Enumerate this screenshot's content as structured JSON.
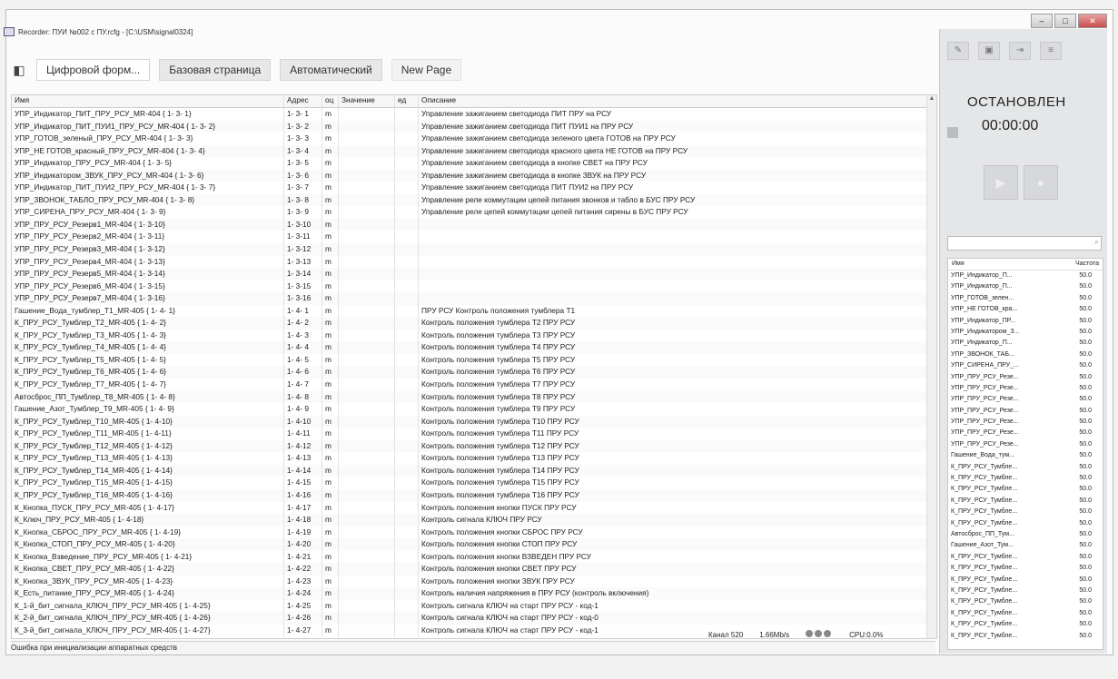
{
  "window": {
    "title": "Recorder: ПУИ №002 с ПУ.rcfg - [C:\\USM\\signal0324]"
  },
  "toolbar": {
    "tabs": [
      "Цифровой форм...",
      "Базовая страница",
      "Автоматический",
      "New Page"
    ]
  },
  "grid": {
    "columns": [
      "Имя",
      "Адрес",
      "оц",
      "Значение",
      "ед",
      "Описание"
    ],
    "rows": [
      [
        "УПР_Индикатор_ПИТ_ПРУ_РСУ_MR-404 { 1- 3- 1}",
        "1- 3- 1",
        "m",
        "",
        "",
        "Управление зажиганием светодиода ПИТ ПРУ на РСУ"
      ],
      [
        "УПР_Индикатор_ПИТ_ПУИ1_ПРУ_РСУ_MR-404 { 1- 3- 2}",
        "1- 3- 2",
        "m",
        "",
        "",
        "Управление зажиганием светодиода ПИТ ПУИ1 на ПРУ РСУ"
      ],
      [
        "УПР_ГОТОВ_зеленый_ПРУ_РСУ_MR-404 { 1- 3- 3}",
        "1- 3- 3",
        "m",
        "",
        "",
        "Управление зажиганием светодиода зеленого цвета ГОТОВ на ПРУ РСУ"
      ],
      [
        "УПР_НЕ ГОТОВ_красный_ПРУ_РСУ_MR-404 { 1- 3- 4}",
        "1- 3- 4",
        "m",
        "",
        "",
        "Управление зажиганием светодиода красного цвета НЕ ГОТОВ на ПРУ РСУ"
      ],
      [
        "УПР_Индикатор_ПРУ_РСУ_MR-404 { 1- 3- 5}",
        "1- 3- 5",
        "m",
        "",
        "",
        "Управление зажиганием светодиода в кнопке СВЕТ на ПРУ РСУ"
      ],
      [
        "УПР_Индикатором_ЗВУК_ПРУ_РСУ_MR-404 { 1- 3- 6}",
        "1- 3- 6",
        "m",
        "",
        "",
        "Управление зажиганием светодиода в кнопке ЗВУК на ПРУ РСУ"
      ],
      [
        "УПР_Индикатор_ПИТ_ПУИ2_ПРУ_РСУ_MR-404 { 1- 3- 7}",
        "1- 3- 7",
        "m",
        "",
        "",
        "Управление зажиганием светодиода ПИТ ПУИ2 на ПРУ РСУ"
      ],
      [
        "УПР_ЗВОНОК_ТАБЛО_ПРУ_РСУ_MR-404 { 1- 3- 8}",
        "1- 3- 8",
        "m",
        "",
        "",
        "Управление реле коммутации цепей питания звонков и табло в БУС ПРУ РСУ"
      ],
      [
        "УПР_СИРЕНА_ПРУ_РСУ_MR-404 { 1- 3- 9}",
        "1- 3- 9",
        "m",
        "",
        "",
        "Управление реле цепей коммутации цепей питания сирены в БУС ПРУ РСУ"
      ],
      [
        "УПР_ПРУ_РСУ_Резерв1_MR-404 { 1- 3-10}",
        "1- 3-10",
        "m",
        "",
        "",
        ""
      ],
      [
        "УПР_ПРУ_РСУ_Резерв2_MR-404 { 1- 3-11}",
        "1- 3-11",
        "m",
        "",
        "",
        ""
      ],
      [
        "УПР_ПРУ_РСУ_Резерв3_MR-404 { 1- 3-12}",
        "1- 3-12",
        "m",
        "",
        "",
        ""
      ],
      [
        "УПР_ПРУ_РСУ_Резерв4_MR-404 { 1- 3-13}",
        "1- 3-13",
        "m",
        "",
        "",
        ""
      ],
      [
        "УПР_ПРУ_РСУ_Резерв5_MR-404 { 1- 3-14}",
        "1- 3-14",
        "m",
        "",
        "",
        ""
      ],
      [
        "УПР_ПРУ_РСУ_Резерв6_MR-404 { 1- 3-15}",
        "1- 3-15",
        "m",
        "",
        "",
        ""
      ],
      [
        "УПР_ПРУ_РСУ_Резерв7_MR-404 { 1- 3-16}",
        "1- 3-16",
        "m",
        "",
        "",
        ""
      ],
      [
        "Гашение_Вода_тумблер_Т1_MR-405 { 1- 4- 1}",
        "1- 4- 1",
        "m",
        "",
        "",
        "ПРУ РСУ Контроль положения тумблера Т1"
      ],
      [
        "К_ПРУ_РСУ_Тумблер_Т2_MR-405 { 1- 4- 2}",
        "1- 4- 2",
        "m",
        "",
        "",
        "Контроль положения тумблера Т2 ПРУ РСУ"
      ],
      [
        "К_ПРУ_РСУ_Тумблер_Т3_MR-405 { 1- 4- 3}",
        "1- 4- 3",
        "m",
        "",
        "",
        "Контроль положения тумблера Т3 ПРУ РСУ"
      ],
      [
        "К_ПРУ_РСУ_Тумблер_Т4_MR-405 { 1- 4- 4}",
        "1- 4- 4",
        "m",
        "",
        "",
        "Контроль положения тумблера Т4 ПРУ РСУ"
      ],
      [
        "К_ПРУ_РСУ_Тумблер_Т5_MR-405 { 1- 4- 5}",
        "1- 4- 5",
        "m",
        "",
        "",
        "Контроль положения тумблера Т5 ПРУ РСУ"
      ],
      [
        "К_ПРУ_РСУ_Тумблер_Т6_MR-405 { 1- 4- 6}",
        "1- 4- 6",
        "m",
        "",
        "",
        "Контроль положения тумблера Т6 ПРУ РСУ"
      ],
      [
        "К_ПРУ_РСУ_Тумблер_Т7_MR-405 { 1- 4- 7}",
        "1- 4- 7",
        "m",
        "",
        "",
        "Контроль положения тумблера Т7 ПРУ РСУ"
      ],
      [
        "Автосброс_ПП_Тумблер_Т8_MR-405 { 1- 4- 8}",
        "1- 4- 8",
        "m",
        "",
        "",
        "Контроль положения тумблера Т8 ПРУ РСУ"
      ],
      [
        "Гашение_Азот_Тумблер_Т9_MR-405 { 1- 4- 9}",
        "1- 4- 9",
        "m",
        "",
        "",
        "Контроль положения тумблера Т9 ПРУ РСУ"
      ],
      [
        "К_ПРУ_РСУ_Тумблер_Т10_MR-405 { 1- 4-10}",
        "1- 4-10",
        "m",
        "",
        "",
        "Контроль положения тумблера Т10 ПРУ РСУ"
      ],
      [
        "К_ПРУ_РСУ_Тумблер_Т11_MR-405 { 1- 4-11}",
        "1- 4-11",
        "m",
        "",
        "",
        "Контроль положения тумблера Т11 ПРУ РСУ"
      ],
      [
        "К_ПРУ_РСУ_Тумблер_Т12_MR-405 { 1- 4-12}",
        "1- 4-12",
        "m",
        "",
        "",
        "Контроль положения тумблера Т12 ПРУ РСУ"
      ],
      [
        "К_ПРУ_РСУ_Тумблер_Т13_MR-405 { 1- 4-13}",
        "1- 4-13",
        "m",
        "",
        "",
        "Контроль положения тумблера Т13 ПРУ РСУ"
      ],
      [
        "К_ПРУ_РСУ_Тумблер_Т14_MR-405 { 1- 4-14}",
        "1- 4-14",
        "m",
        "",
        "",
        "Контроль положения тумблера Т14 ПРУ РСУ"
      ],
      [
        "К_ПРУ_РСУ_Тумблер_Т15_MR-405 { 1- 4-15}",
        "1- 4-15",
        "m",
        "",
        "",
        "Контроль положения тумблера Т15 ПРУ РСУ"
      ],
      [
        "К_ПРУ_РСУ_Тумблер_Т16_MR-405 { 1- 4-16}",
        "1- 4-16",
        "m",
        "",
        "",
        "Контроль положения тумблера Т16 ПРУ РСУ"
      ],
      [
        "К_Кнопка_ПУСК_ПРУ_РСУ_MR-405 { 1- 4-17}",
        "1- 4-17",
        "m",
        "",
        "",
        "Контроль положения кнопки ПУСК ПРУ РСУ"
      ],
      [
        "К_Ключ_ПРУ_РСУ_MR-405 { 1- 4-18}",
        "1- 4-18",
        "m",
        "",
        "",
        "Контроль сигнала КЛЮЧ ПРУ РСУ"
      ],
      [
        "К_Кнопка_СБРОС_ПРУ_РСУ_MR-405 { 1- 4-19}",
        "1- 4-19",
        "m",
        "",
        "",
        "Контроль положения кнопки СБРОС ПРУ РСУ"
      ],
      [
        "К_Кнопка_СТОП_ПРУ_РСУ_MR-405 { 1- 4-20}",
        "1- 4-20",
        "m",
        "",
        "",
        "Контроль положения кнопки СТОП ПРУ РСУ"
      ],
      [
        "К_Кнопка_Взведение_ПРУ_РСУ_MR-405 { 1- 4-21}",
        "1- 4-21",
        "m",
        "",
        "",
        "Контроль положения кнопки ВЗВЕДЕН ПРУ РСУ"
      ],
      [
        "К_Кнопка_СВЕТ_ПРУ_РСУ_MR-405 { 1- 4-22}",
        "1- 4-22",
        "m",
        "",
        "",
        "Контроль положения кнопки СВЕТ ПРУ РСУ"
      ],
      [
        "К_Кнопка_ЗВУК_ПРУ_РСУ_MR-405 { 1- 4-23}",
        "1- 4-23",
        "m",
        "",
        "",
        "Контроль положения кнопки ЗВУК ПРУ РСУ"
      ],
      [
        "К_Есть_питание_ПРУ_РСУ_MR-405 { 1- 4-24}",
        "1- 4-24",
        "m",
        "",
        "",
        "Контроль наличия напряжения в ПРУ РСУ (контроль включения)"
      ],
      [
        "К_1-й_бит_сигнала_КЛЮЧ_ПРУ_РСУ_MR-405 { 1- 4-25}",
        "1- 4-25",
        "m",
        "",
        "",
        "Контроль сигнала КЛЮЧ на старт ПРУ РСУ - код-1"
      ],
      [
        "К_2-й_бит_сигнала_КЛЮЧ_ПРУ_РСУ_MR-405 { 1- 4-26}",
        "1- 4-26",
        "m",
        "",
        "",
        "Контроль сигнала КЛЮЧ на старт ПРУ РСУ - код-0"
      ],
      [
        "К_3-й_бит_сигнала_КЛЮЧ_ПРУ_РСУ_MR-405 { 1- 4-27}",
        "1- 4-27",
        "m",
        "",
        "",
        "Контроль сигнала КЛЮЧ на старт ПРУ РСУ - код-1"
      ]
    ]
  },
  "status": {
    "message": "Ошибка при инициализации аппаратных средств",
    "channels": "Канал 520",
    "rate": "1.66Mb/s",
    "cpu": "CPU:0.0%"
  },
  "recorder": {
    "state": "ОСТАНОВЛЕН",
    "time": "00:00:00",
    "columns": [
      "Имя",
      "Частота"
    ],
    "rows": [
      [
        "УПР_Индикатор_П...",
        "50.0"
      ],
      [
        "УПР_Индикатор_П...",
        "50.0"
      ],
      [
        "УПР_ГОТОВ_зелен...",
        "50.0"
      ],
      [
        "УПР_НЕ ГОТОВ_кра...",
        "50.0"
      ],
      [
        "УПР_Индикатор_ПР...",
        "50.0"
      ],
      [
        "УПР_Индикатором_З...",
        "50.0"
      ],
      [
        "УПР_Индикатор_П...",
        "50.0"
      ],
      [
        "УПР_ЗВОНОК_ТАБ...",
        "50.0"
      ],
      [
        "УПР_СИРЕНА_ПРУ_...",
        "50.0"
      ],
      [
        "УПР_ПРУ_РСУ_Резе...",
        "50.0"
      ],
      [
        "УПР_ПРУ_РСУ_Резе...",
        "50.0"
      ],
      [
        "УПР_ПРУ_РСУ_Резе...",
        "50.0"
      ],
      [
        "УПР_ПРУ_РСУ_Резе...",
        "50.0"
      ],
      [
        "УПР_ПРУ_РСУ_Резе...",
        "50.0"
      ],
      [
        "УПР_ПРУ_РСУ_Резе...",
        "50.0"
      ],
      [
        "УПР_ПРУ_РСУ_Резе...",
        "50.0"
      ],
      [
        "Гашение_Вода_тум...",
        "50.0"
      ],
      [
        "К_ПРУ_РСУ_Тумбле...",
        "50.0"
      ],
      [
        "К_ПРУ_РСУ_Тумбле...",
        "50.0"
      ],
      [
        "К_ПРУ_РСУ_Тумбле...",
        "50.0"
      ],
      [
        "К_ПРУ_РСУ_Тумбле...",
        "50.0"
      ],
      [
        "К_ПРУ_РСУ_Тумбле...",
        "50.0"
      ],
      [
        "К_ПРУ_РСУ_Тумбле...",
        "50.0"
      ],
      [
        "Автосброс_ПП_Тум...",
        "50.0"
      ],
      [
        "Гашение_Азот_Тум...",
        "50.0"
      ],
      [
        "К_ПРУ_РСУ_Тумбле...",
        "50.0"
      ],
      [
        "К_ПРУ_РСУ_Тумбле...",
        "50.0"
      ],
      [
        "К_ПРУ_РСУ_Тумбле...",
        "50.0"
      ],
      [
        "К_ПРУ_РСУ_Тумбле...",
        "50.0"
      ],
      [
        "К_ПРУ_РСУ_Тумбле...",
        "50.0"
      ],
      [
        "К_ПРУ_РСУ_Тумбле...",
        "50.0"
      ],
      [
        "К_ПРУ_РСУ_Тумбле...",
        "50.0"
      ],
      [
        "К_ПРУ_РСУ_Тумбле...",
        "50.0"
      ]
    ]
  }
}
